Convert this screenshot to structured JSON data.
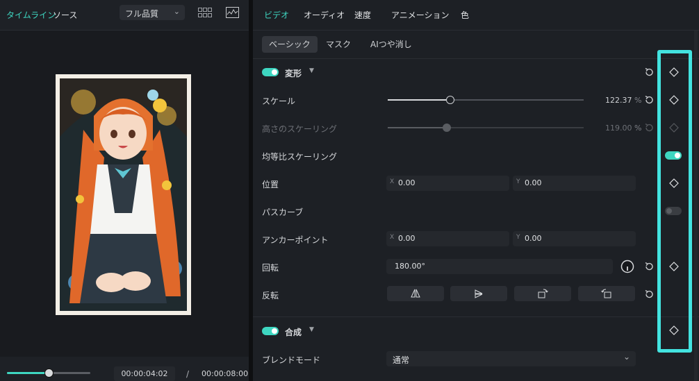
{
  "left": {
    "tabs": [
      "タイムライン",
      "ソース"
    ],
    "quality": "フル品質",
    "icons": [
      "grid-view-icon",
      "waveform-icon"
    ],
    "time_current": "00:00:04:02",
    "time_separator": "/",
    "time_total": "00:00:08:00",
    "playback_progress": 0.5
  },
  "topnav": {
    "tabs": [
      "ビデオ",
      "オーディオ",
      "速度",
      "アニメーション",
      "色"
    ],
    "active": "ビデオ"
  },
  "subtabs": {
    "items": [
      "ベーシック",
      "マスク",
      "AIつや消し"
    ],
    "active": "ベーシック"
  },
  "transform": {
    "title": "変形",
    "enabled": true,
    "scale": {
      "label": "スケール",
      "value": "122.37",
      "unit": "%",
      "slider": 0.32
    },
    "height_scale": {
      "label": "高さのスケーリング",
      "value": "119.00",
      "unit": "%",
      "slider": 0.3
    },
    "uniform": {
      "label": "均等比スケーリング",
      "enabled": true
    },
    "position": {
      "label": "位置",
      "x_axis": "X",
      "x": "0.00",
      "y_axis": "Y",
      "y": "0.00"
    },
    "path_curve": {
      "label": "パスカーブ",
      "enabled": false
    },
    "anchor": {
      "label": "アンカーポイント",
      "x_axis": "X",
      "x": "0.00",
      "y_axis": "Y",
      "y": "0.00"
    },
    "rotation": {
      "label": "回転",
      "value": "180.00°"
    },
    "flip": {
      "label": "反転"
    }
  },
  "composite": {
    "title": "合成",
    "enabled": true,
    "blend_mode": {
      "label": "ブレンドモード",
      "value": "通常"
    }
  },
  "colors": {
    "accent": "#3ed6c1",
    "highlight": "#43e3e0"
  }
}
